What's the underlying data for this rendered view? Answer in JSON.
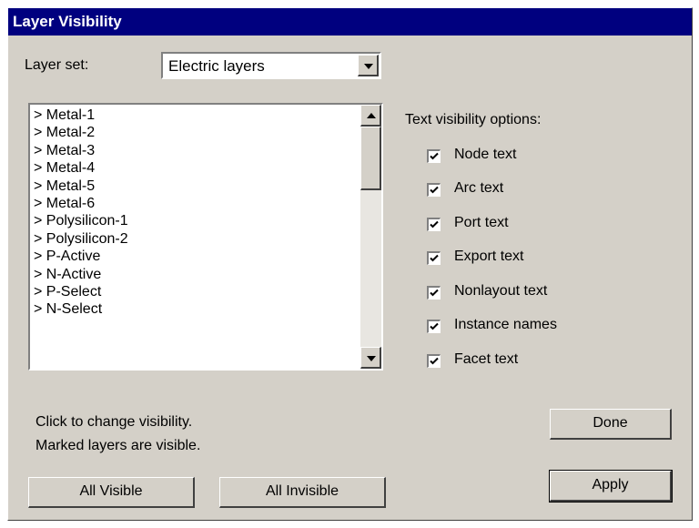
{
  "title": "Layer Visibility",
  "layer_set": {
    "label": "Layer set:",
    "value": "Electric layers"
  },
  "layers": [
    "> Metal-1",
    "> Metal-2",
    "> Metal-3",
    "> Metal-4",
    "> Metal-5",
    "> Metal-6",
    "> Polysilicon-1",
    "> Polysilicon-2",
    "> P-Active",
    "> N-Active",
    "> P-Select",
    "> N-Select"
  ],
  "text_options": {
    "heading": "Text visibility options:",
    "items": [
      {
        "label": "Node text",
        "checked": true
      },
      {
        "label": "Arc text",
        "checked": true
      },
      {
        "label": "Port text",
        "checked": true
      },
      {
        "label": "Export text",
        "checked": true
      },
      {
        "label": "Nonlayout text",
        "checked": true
      },
      {
        "label": "Instance names",
        "checked": true
      },
      {
        "label": "Facet text",
        "checked": true
      }
    ]
  },
  "hint": {
    "line1": "Click to change visibility.",
    "line2": "Marked layers are visible."
  },
  "buttons": {
    "all_visible": "All Visible",
    "all_invisible": "All Invisible",
    "done": "Done",
    "apply": "Apply"
  },
  "icons": {
    "scroll_up": "scroll-up-arrow-icon",
    "scroll_down": "scroll-down-arrow-icon",
    "dropdown": "chevron-down-icon",
    "check": "checkmark-icon"
  }
}
